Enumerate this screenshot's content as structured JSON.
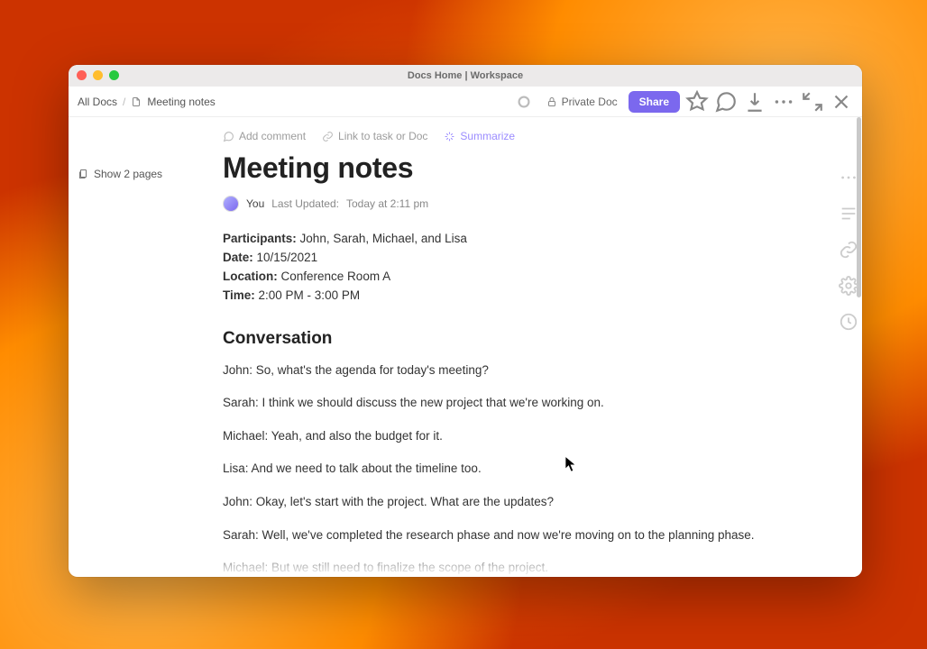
{
  "titlebar": {
    "title": "Docs Home | Workspace"
  },
  "breadcrumbs": {
    "root": "All Docs",
    "current": "Meeting notes"
  },
  "topbar": {
    "private_label": "Private Doc",
    "share_label": "Share"
  },
  "left_rail": {
    "show_pages": "Show 2 pages"
  },
  "doc_actions": {
    "comment": "Add comment",
    "link": "Link to task or Doc",
    "summarize": "Summarize"
  },
  "doc": {
    "title": "Meeting notes",
    "author": "You",
    "last_updated_label": "Last Updated:",
    "last_updated_value": "Today at 2:11 pm"
  },
  "meta": {
    "participants_label": "Participants:",
    "participants_value": "John, Sarah, Michael, and Lisa",
    "date_label": "Date:",
    "date_value": "10/15/2021",
    "location_label": "Location:",
    "location_value": "Conference Room A",
    "time_label": "Time:",
    "time_value": "2:00 PM - 3:00 PM"
  },
  "section_heading": "Conversation",
  "conversation": [
    "John: So, what's the agenda for today's meeting?",
    "Sarah: I think we should discuss the new project that we're working on.",
    "Michael: Yeah, and also the budget for it.",
    "Lisa: And we need to talk about the timeline too.",
    "John: Okay, let's start with the project. What are the updates?",
    "Sarah: Well, we've completed the research phase and now we're moving on to the planning phase.",
    "Michael: But we still need to finalize the scope of the project."
  ]
}
